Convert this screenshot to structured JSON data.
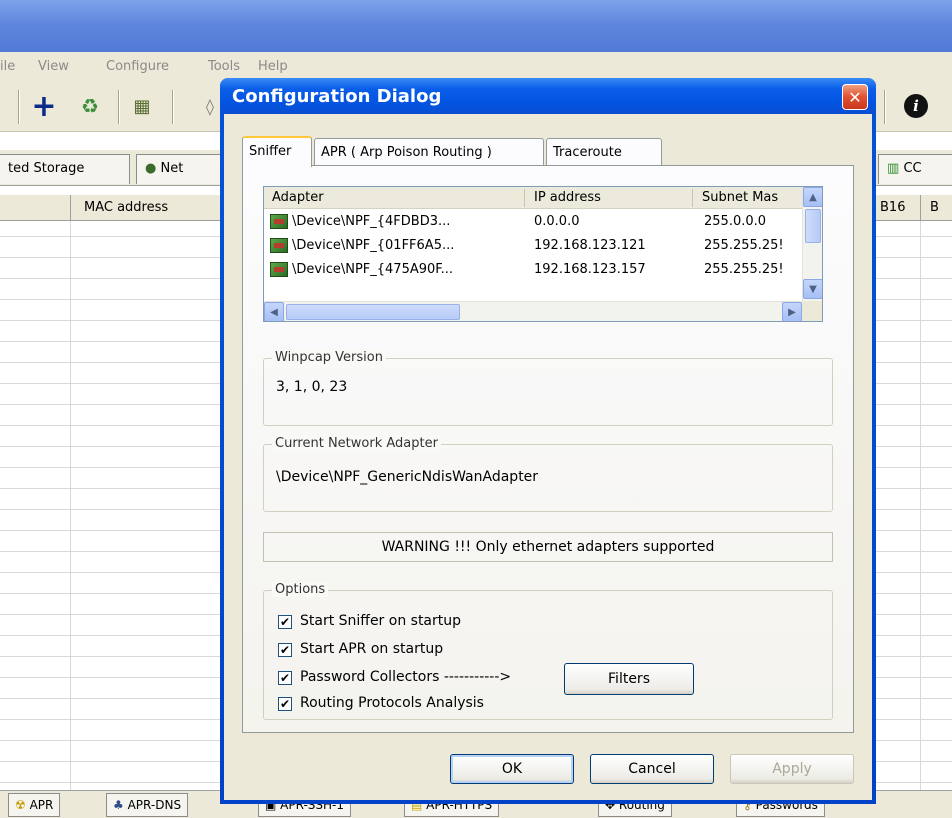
{
  "app": {
    "menu": [
      "ile",
      "View",
      "Configure",
      "Tools",
      "Help"
    ],
    "tabs": [
      "ted Storage",
      "Net",
      "CC"
    ],
    "grid_headers": [
      "MAC address",
      "B16",
      "B"
    ],
    "bottom_tabs": [
      "APR",
      "APR-DNS",
      "APR-SSH-1",
      "APR-HTTPS",
      "Routing",
      "Passwords"
    ]
  },
  "dialog": {
    "title": "Configuration Dialog",
    "close_glyph": "✕",
    "tabs": [
      "Sniffer",
      "APR ( Arp Poison Routing )",
      "Traceroute"
    ],
    "adapter_list": {
      "columns": [
        "Adapter",
        "IP address",
        "Subnet Mas"
      ],
      "rows": [
        {
          "adapter": "\\Device\\NPF_{4FDBD3...",
          "ip": "0.0.0.0",
          "mask": "255.0.0.0"
        },
        {
          "adapter": "\\Device\\NPF_{01FF6A5...",
          "ip": "192.168.123.121",
          "mask": "255.255.25!"
        },
        {
          "adapter": "\\Device\\NPF_{475A90F...",
          "ip": "192.168.123.157",
          "mask": "255.255.25!"
        }
      ]
    },
    "winpcap": {
      "label": "Winpcap Version",
      "value": "3, 1, 0, 23"
    },
    "current_adapter": {
      "label": "Current Network Adapter",
      "value": "\\Device\\NPF_GenericNdisWanAdapter"
    },
    "warning": "WARNING !!! Only ethernet adapters supported",
    "options": {
      "label": "Options",
      "items": [
        {
          "label": "Start Sniffer on startup",
          "checked": true
        },
        {
          "label": "Start APR on startup",
          "checked": true
        },
        {
          "label": "Password Collectors ----------->",
          "checked": true
        },
        {
          "label": "Routing Protocols Analysis",
          "checked": true
        }
      ],
      "filters_button": "Filters"
    },
    "buttons": {
      "ok": "OK",
      "cancel": "Cancel",
      "apply": "Apply"
    }
  },
  "colors": {
    "title_blue": "#0254e1",
    "dialog_bg": "#ece9d8",
    "close_red": "#e05030"
  }
}
